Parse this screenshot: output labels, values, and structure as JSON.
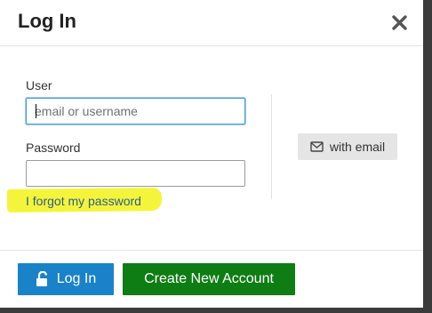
{
  "dialog": {
    "title": "Log In",
    "close_icon": "close-icon"
  },
  "form": {
    "user_label": "User",
    "user_placeholder": "email or username",
    "user_value": "",
    "password_label": "Password",
    "password_value": "",
    "forgot_link": "I forgot my password"
  },
  "alt_login": {
    "email_button_label": "with email",
    "email_icon": "envelope-icon"
  },
  "footer": {
    "login_button_label": "Log In",
    "login_icon": "unlock-icon",
    "create_account_label": "Create New Account"
  },
  "colors": {
    "login_blue": "#1a82c8",
    "create_green": "#0e7d13",
    "highlight_yellow": "#f4f53a",
    "link_blue": "#2b5f8e"
  }
}
